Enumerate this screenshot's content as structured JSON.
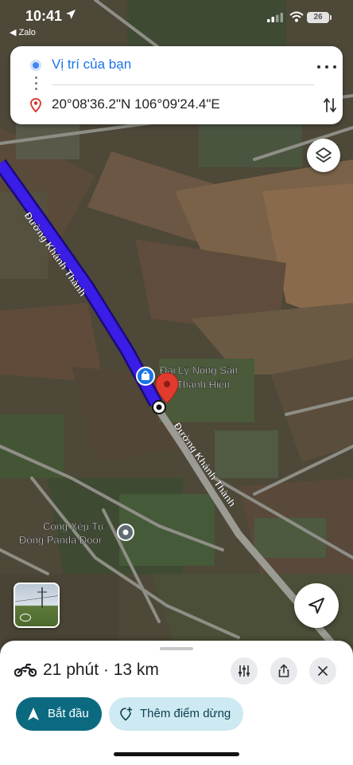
{
  "status_bar": {
    "time": "10:41",
    "back_label": "◀ Zalo",
    "battery": "26"
  },
  "route": {
    "origin": "Vị trí của bạn",
    "destination": "20°08'36.2\"N 106°09'24.4\"E"
  },
  "map": {
    "road_name": "Đường Khánh Thành",
    "places": [
      {
        "name_line1": "Đại Lý Nông Sản",
        "name_line2": "Thành Hiền",
        "icon": "shopping-bag-icon"
      },
      {
        "name_line1": "Cổng Xếp Tự",
        "name_line2": "Động Panda Door",
        "icon": "place-marker-icon"
      }
    ],
    "colors": {
      "route": "#3a1de6",
      "destination_pin": "#e23b2e"
    }
  },
  "trip": {
    "mode_icon": "motorcycle-icon",
    "duration": "21 phút · 13 km",
    "start_label": "Bắt đầu",
    "add_stop_label": "Thêm điểm dừng"
  }
}
